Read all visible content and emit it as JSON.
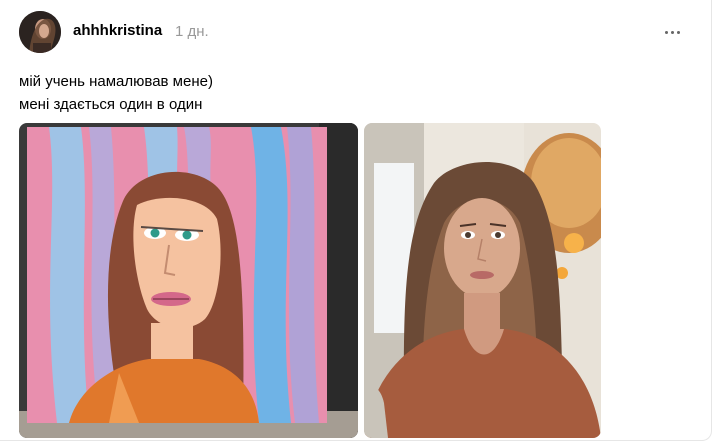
{
  "post": {
    "author": {
      "username": "ahhhkristina",
      "avatar_icon": "user-avatar"
    },
    "timestamp": "1 дн.",
    "menu_icon": "more-horizontal-icon",
    "caption_lines": [
      "мій учень намалював мене)",
      "мені здається один в один"
    ],
    "media": [
      {
        "kind": "photo",
        "subject": "painting-portrait"
      },
      {
        "kind": "photo",
        "subject": "selfie-photo"
      }
    ]
  }
}
